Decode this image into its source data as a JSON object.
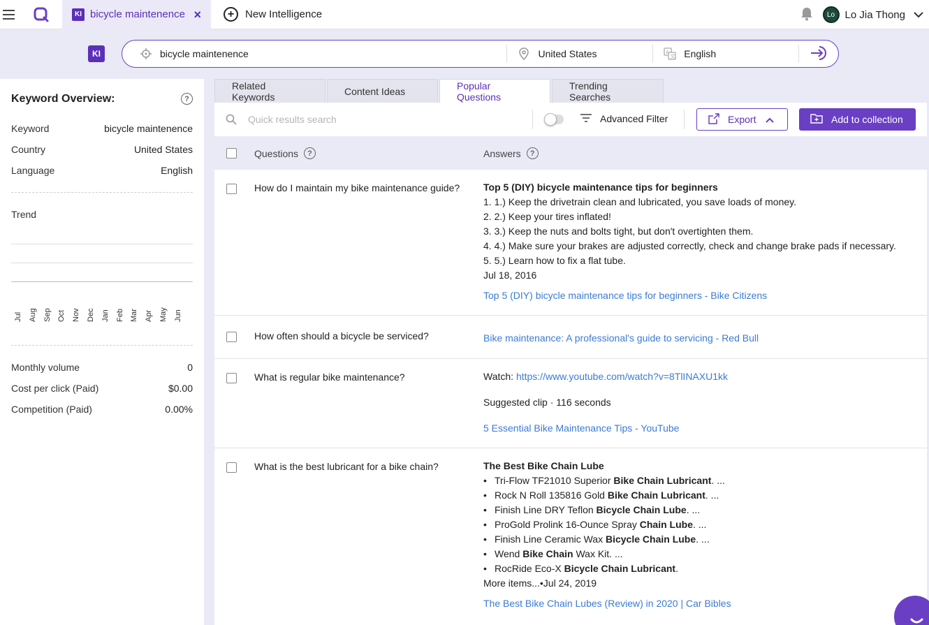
{
  "topbar": {
    "tab_label": "bicycle maintenence",
    "tab_badge": "KI",
    "new_intelligence": "New Intelligence",
    "user_initials": "Lo",
    "user_name": "Lo Jia Thong"
  },
  "search": {
    "badge": "KI",
    "keyword": "bicycle maintenence",
    "country": "United States",
    "language": "English"
  },
  "overview": {
    "title": "Keyword Overview:",
    "keyword_label": "Keyword",
    "keyword_value": "bicycle maintenence",
    "country_label": "Country",
    "country_value": "United States",
    "language_label": "Language",
    "language_value": "English",
    "trend_label": "Trend",
    "months": [
      "Jul",
      "Aug",
      "Sep",
      "Oct",
      "Nov",
      "Dec",
      "Jan",
      "Feb",
      "Mar",
      "Apr",
      "May",
      "Jun"
    ],
    "monthly_volume_label": "Monthly volume",
    "monthly_volume_value": "0",
    "cpc_label": "Cost per click (Paid)",
    "cpc_value": "$0.00",
    "competition_label": "Competition (Paid)",
    "competition_value": "0.00%"
  },
  "tabs": [
    "Related Keywords",
    "Content Ideas",
    "Popular Questions",
    "Trending Searches"
  ],
  "active_tab": "Popular Questions",
  "toolbar": {
    "quick_search_placeholder": "Quick results search",
    "advanced_filter": "Advanced Filter",
    "export": "Export",
    "add_to_collection": "Add to collection"
  },
  "table": {
    "col_questions": "Questions",
    "col_answers": "Answers",
    "rows": [
      {
        "question": "How do I maintain my bike maintenance guide?",
        "answer_title": "Top 5 (DIY) bicycle maintenance tips for beginners",
        "answer_items": [
          "1. 1.) Keep the drivetrain clean and lubricated, you save loads of money.",
          "2. 2.) Keep your tires inflated!",
          "3. 3.) Keep the nuts and bolts tight, but don't overtighten them.",
          "4. 4.) Make sure your brakes are adjusted correctly, check and change brake pads if necessary.",
          "5. 5.) Learn how to fix a flat tube."
        ],
        "answer_date": "Jul 18, 2016",
        "answer_link": "Top 5 (DIY) bicycle maintenance tips for beginners - Bike Citizens"
      },
      {
        "question": "How often should a bicycle be serviced?",
        "answer_link": "Bike maintenance: A professional's guide to servicing - Red Bull"
      },
      {
        "question": "What is regular bike maintenance?",
        "watch_prefix": "Watch: ",
        "watch_url": "https://www.youtube.com/watch?v=8TlINAXU1kk",
        "clip_text": "Suggested clip · 116 seconds",
        "answer_link": "5 Essential Bike Maintenance Tips - YouTube"
      },
      {
        "question": "What is the best lubricant for a bike chain?",
        "answer_title": "The Best Bike Chain Lube",
        "bullets": [
          {
            "pre": "Tri-Flow TF21010 Superior ",
            "bold": "Bike Chain Lubricant",
            "post": ". ..."
          },
          {
            "pre": "Rock N Roll 135816 Gold ",
            "bold": "Bike Chain Lubricant",
            "post": ". ..."
          },
          {
            "pre": "Finish Line DRY Teflon ",
            "bold": "Bicycle Chain Lube",
            "post": ". ..."
          },
          {
            "pre": "ProGold Prolink 16-Ounce Spray ",
            "bold": "Chain Lube",
            "post": ". ..."
          },
          {
            "pre": "Finish Line Ceramic Wax ",
            "bold": "Bicycle Chain Lube",
            "post": ". ..."
          },
          {
            "pre": "Wend ",
            "bold": "Bike Chain",
            "post": " Wax Kit. ..."
          },
          {
            "pre": "RocRide Eco-X ",
            "bold": "Bicycle Chain Lubricant",
            "post": "."
          }
        ],
        "more": "More items...•Jul 24, 2019",
        "answer_link": "The Best Bike Chain Lubes (Review) in 2020 | Car Bibles"
      }
    ]
  },
  "colors": {
    "accent": "#6a3fc4",
    "link": "#3a7bd5",
    "background": "#e9eaf6"
  }
}
